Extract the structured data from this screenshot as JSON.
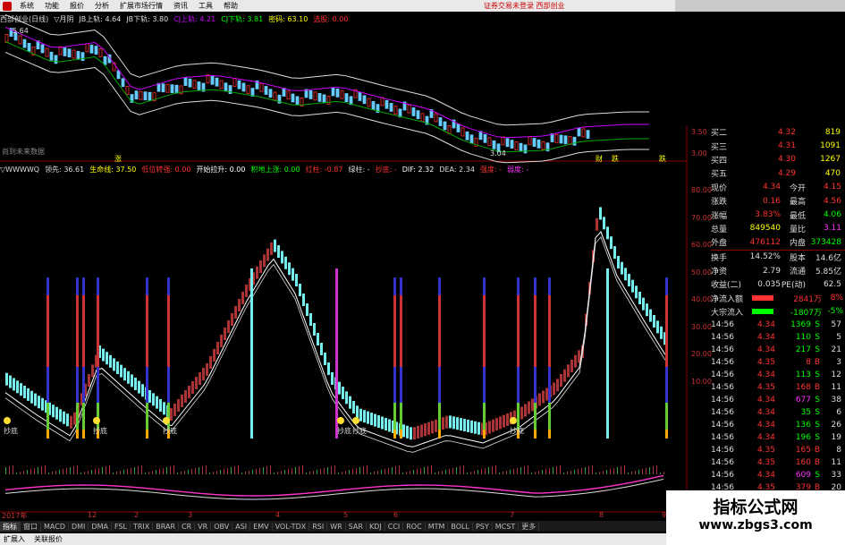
{
  "menu": {
    "items": [
      "系统",
      "功能",
      "报价",
      "分析",
      "扩展市场行情",
      "资讯",
      "工具",
      "帮助"
    ],
    "status": "证券交易未登录 西部创业"
  },
  "kline": {
    "title": "西部创业(日线)",
    "fields": [
      {
        "label": "▽月阴",
        "color": "#ddd"
      },
      {
        "label": "JB上轨: 4.64",
        "color": "#ddd"
      },
      {
        "label": "JB下轨: 3.80",
        "color": "#ddd"
      },
      {
        "label": "CJ上轨: 4.21",
        "color": "#c0f"
      },
      {
        "label": "CJ下轨: 3.81",
        "color": "#0f0"
      },
      {
        "label": "密码: 63.10",
        "color": "#ff0"
      },
      {
        "label": "选股: 0.00",
        "color": "#f33"
      }
    ],
    "high_label": "5.64",
    "low_label": "3.04",
    "y_ticks": [
      "3.50",
      "3.00"
    ],
    "bottom_label": "尚到未来数据",
    "markers": [
      "涨",
      "财",
      "跌",
      "跌"
    ]
  },
  "indicator": {
    "fields": [
      {
        "label": "▽WWWWQ",
        "color": "#ddd"
      },
      {
        "label": "领先: 36.61",
        "color": "#ddd"
      },
      {
        "label": "生命线: 37.50",
        "color": "#ff0"
      },
      {
        "label": "低位转强: 0.00",
        "color": "#f33"
      },
      {
        "label": "开始拉升: 0.00",
        "color": "#fff"
      },
      {
        "label": "积地上涨: 0.00",
        "color": "#0f0"
      },
      {
        "label": "红柱: -0.87",
        "color": "#f33"
      },
      {
        "label": "绿柱: -",
        "color": "#ddd"
      },
      {
        "label": "抄底: -",
        "color": "#f33"
      },
      {
        "label": "DIF: 2.32",
        "color": "#fff"
      },
      {
        "label": "DEA: 2.34",
        "color": "#ddd"
      },
      {
        "label": "强度: -",
        "color": "#f33"
      },
      {
        "label": "弱度: -",
        "color": "#f3f"
      }
    ],
    "y_ticks": [
      "80.00",
      "70.00",
      "60.00",
      "50.00",
      "40.00",
      "30.00",
      "20.00",
      "10.00"
    ],
    "buy_label": "抄底"
  },
  "quote": {
    "asks": [
      {
        "label": "买二",
        "price": "4.32",
        "vol": "819"
      },
      {
        "label": "买三",
        "price": "4.31",
        "vol": "1091"
      },
      {
        "label": "买四",
        "price": "4.30",
        "vol": "1267"
      },
      {
        "label": "买五",
        "price": "4.29",
        "vol": "470"
      }
    ],
    "stats": [
      {
        "l1": "现价",
        "v1": "4.34",
        "l2": "今开",
        "v2": "4.15",
        "c1": "#f33",
        "c2": "#f33"
      },
      {
        "l1": "涨跌",
        "v1": "0.16",
        "l2": "最高",
        "v2": "4.56",
        "c1": "#f33",
        "c2": "#f33"
      },
      {
        "l1": "涨幅",
        "v1": "3.83%",
        "l2": "最低",
        "v2": "4.06",
        "c1": "#f33",
        "c2": "#0f0"
      },
      {
        "l1": "总量",
        "v1": "849540",
        "l2": "量比",
        "v2": "3.11",
        "c1": "#ff0",
        "c2": "#f3f"
      },
      {
        "l1": "外盘",
        "v1": "476112",
        "l2": "内盘",
        "v2": "373428",
        "c1": "#f33",
        "c2": "#0f0"
      },
      {
        "l1": "换手",
        "v1": "14.52%",
        "l2": "股本",
        "v2": "14.6亿",
        "c1": "#ddd",
        "c2": "#ddd"
      },
      {
        "l1": "净资",
        "v1": "2.79",
        "l2": "流通",
        "v2": "5.85亿",
        "c1": "#ddd",
        "c2": "#ddd"
      },
      {
        "l1": "收益(二)",
        "v1": "0.035",
        "l2": "PE(动)",
        "v2": "62.5",
        "c1": "#ddd",
        "c2": "#ddd"
      }
    ],
    "flows": [
      {
        "label": "净流入额",
        "amount": "2841万",
        "pct": "8%",
        "color": "#f33"
      },
      {
        "label": "大宗流入",
        "amount": "-1807万",
        "pct": "-5%",
        "color": "#0f0"
      }
    ],
    "ticks": [
      {
        "t": "14:56",
        "p": "4.34",
        "v": "1369",
        "c": "S",
        "n": "57",
        "vc": "#0f0"
      },
      {
        "t": "14:56",
        "p": "4.34",
        "v": "110",
        "c": "S",
        "n": "5",
        "vc": "#0f0"
      },
      {
        "t": "14:56",
        "p": "4.34",
        "v": "217",
        "c": "S",
        "n": "21",
        "vc": "#0f0"
      },
      {
        "t": "14:56",
        "p": "4.35",
        "v": "8",
        "c": "B",
        "n": "3",
        "vc": "#f33"
      },
      {
        "t": "14:56",
        "p": "4.34",
        "v": "113",
        "c": "S",
        "n": "12",
        "vc": "#0f0"
      },
      {
        "t": "14:56",
        "p": "4.35",
        "v": "168",
        "c": "B",
        "n": "11",
        "vc": "#f33"
      },
      {
        "t": "14:56",
        "p": "4.34",
        "v": "677",
        "c": "S",
        "n": "38",
        "vc": "#f3f"
      },
      {
        "t": "14:56",
        "p": "4.34",
        "v": "35",
        "c": "S",
        "n": "6",
        "vc": "#0f0"
      },
      {
        "t": "14:56",
        "p": "4.34",
        "v": "136",
        "c": "S",
        "n": "26",
        "vc": "#0f0"
      },
      {
        "t": "14:56",
        "p": "4.34",
        "v": "196",
        "c": "S",
        "n": "19",
        "vc": "#0f0"
      },
      {
        "t": "14:56",
        "p": "4.35",
        "v": "165",
        "c": "B",
        "n": "8",
        "vc": "#f33"
      },
      {
        "t": "14:56",
        "p": "4.35",
        "v": "160",
        "c": "B",
        "n": "11",
        "vc": "#f33"
      },
      {
        "t": "14:56",
        "p": "4.34",
        "v": "609",
        "c": "S",
        "n": "33",
        "vc": "#f3f"
      },
      {
        "t": "14:56",
        "p": "4.35",
        "v": "379",
        "c": "B",
        "n": "20",
        "vc": "#f33"
      }
    ]
  },
  "time_axis": [
    "2017年",
    "12",
    "2",
    "3",
    "4",
    "5",
    "6",
    "7",
    "8",
    "9"
  ],
  "tabs": [
    "指标",
    "窗口",
    "MACD",
    "DMI",
    "DMA",
    "FSL",
    "TRIX",
    "BRAR",
    "CR",
    "VR",
    "OBV",
    "ASI",
    "EMV",
    "VOL-TDX",
    "RSI",
    "WR",
    "SAR",
    "KDJ",
    "CCI",
    "ROC",
    "MTM",
    "BOLL",
    "PSY",
    "MCST",
    "更多"
  ],
  "bottom": [
    "扩展入",
    "关联报价"
  ],
  "watermark": {
    "line1": "指标公式网",
    "line2": "www.zbgs3.com"
  }
}
